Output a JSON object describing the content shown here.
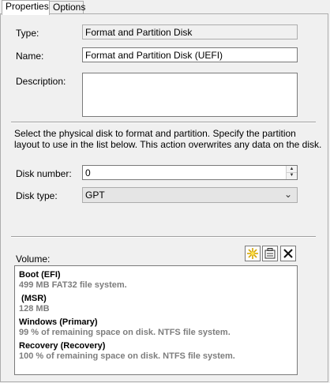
{
  "tabs": [
    {
      "label": "Properties",
      "active": true
    },
    {
      "label": "Options",
      "active": false
    }
  ],
  "form": {
    "type_label": "Type:",
    "type_value": "Format and Partition Disk",
    "name_label": "Name:",
    "name_value": "Format and Partition Disk (UEFI)",
    "description_label": "Description:",
    "description_value": ""
  },
  "instructions": "Select the physical disk to format and partition.  Specify the partition layout to use in the list below. This action overwrites any data on the disk.",
  "disk": {
    "number_label": "Disk number:",
    "number_value": "0",
    "type_label": "Disk type:",
    "type_value": "GPT"
  },
  "volume": {
    "label": "Volume:",
    "items": [
      {
        "title": "Boot (EFI)",
        "detail": "499 MB FAT32 file system."
      },
      {
        "title": " (MSR)",
        "detail": "128 MB"
      },
      {
        "title": "Windows (Primary)",
        "detail": "99 % of remaining space on disk. NTFS file system."
      },
      {
        "title": "Recovery (Recovery)",
        "detail": "100 % of remaining space on disk. NTFS file system."
      }
    ]
  },
  "icons": {
    "new_volume": "new-star-icon",
    "properties": "properties-icon",
    "delete": "delete-x-icon"
  }
}
